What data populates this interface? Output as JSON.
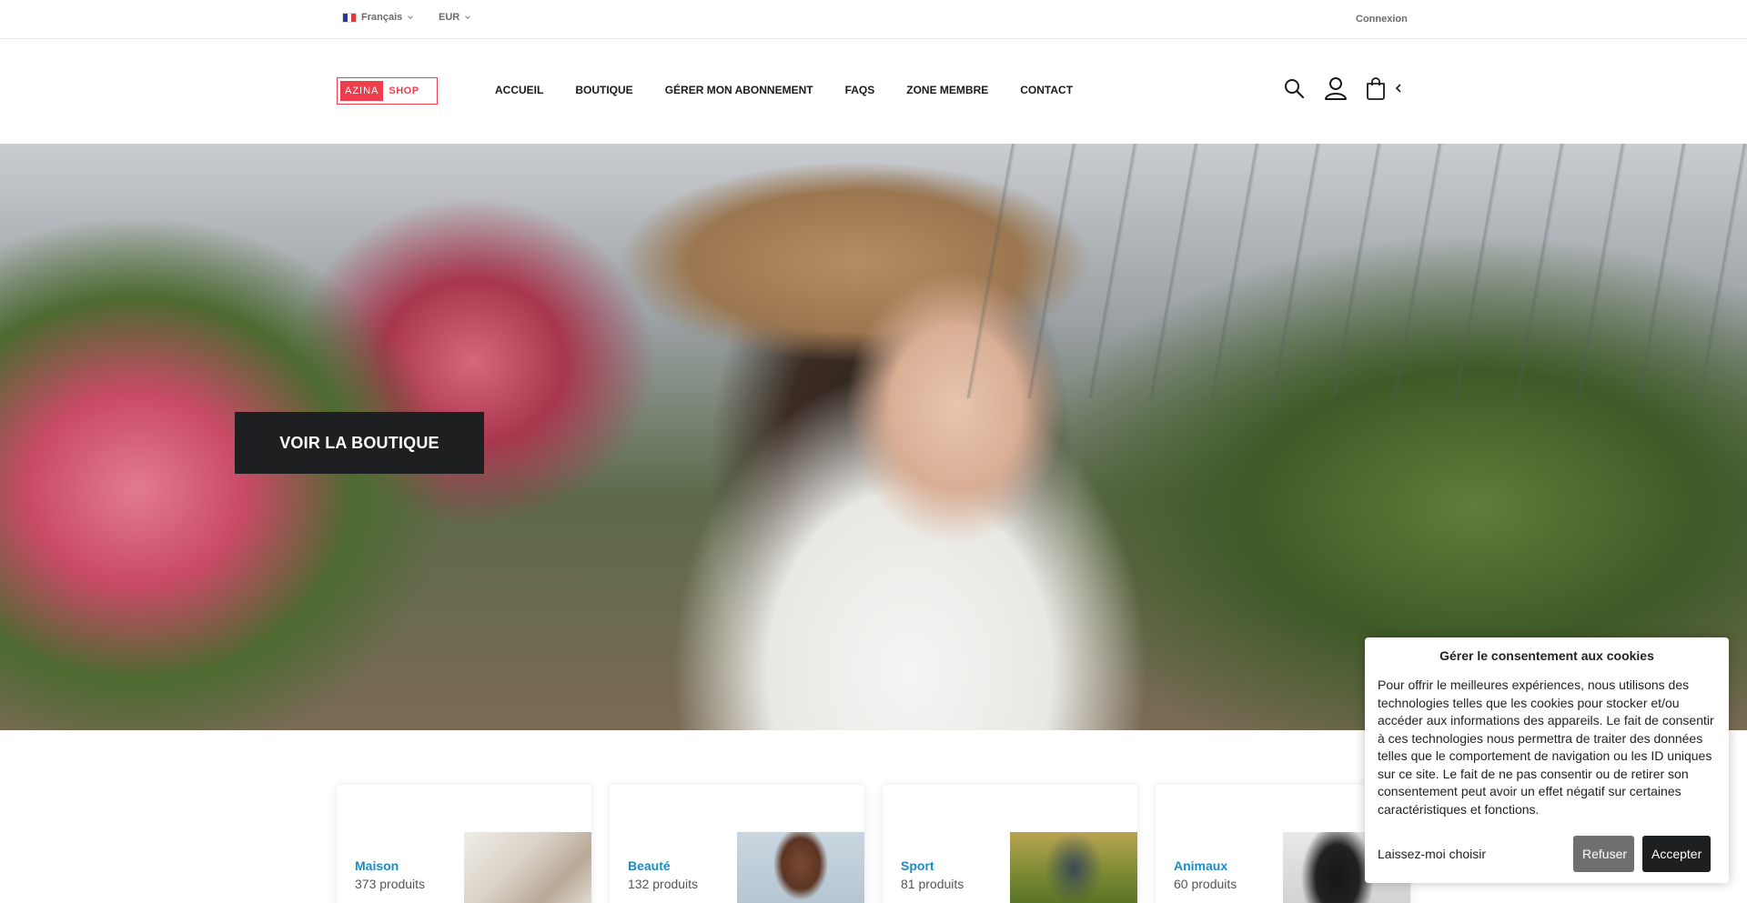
{
  "topbar": {
    "language": "Français",
    "currency": "EUR",
    "login": "Connexion"
  },
  "header": {
    "logo_part1": "AZINA",
    "logo_part2": "SHOP",
    "nav": [
      "ACCUEIL",
      "BOUTIQUE",
      "GÉRER MON ABONNEMENT",
      "FAQS",
      "ZONE MEMBRE",
      "CONTACT"
    ],
    "icons": [
      "search-icon",
      "user-icon",
      "bag-icon",
      "chevron-left-icon"
    ]
  },
  "hero": {
    "button_label": "VOIR LA BOUTIQUE"
  },
  "categories": [
    {
      "name": "Maison",
      "count": "373 produits"
    },
    {
      "name": "Beauté",
      "count": "132 produits"
    },
    {
      "name": "Sport",
      "count": "81 produits"
    },
    {
      "name": "Animaux",
      "count": "60 produits"
    }
  ],
  "cookie": {
    "title": "Gérer le consentement aux cookies",
    "text": "Pour offrir le meilleures expériences, nous utilisons des technologies telles que les cookies pour stocker et/ou accéder aux informations des appareils. Le fait de consentir à ces technologies nous permettra de traiter des données telles que le comportement de navigation ou les ID uniques sur ce site. Le fait de ne pas consentir ou de retirer son consentement peut avoir un effet négatif sur certaines caractéristiques et fonctions.",
    "preferences": "Laissez-moi choisir",
    "refuse": "Refuser",
    "accept": "Accepter"
  },
  "colors": {
    "brand": "#ee3e4e",
    "link": "#1b8dc0",
    "dark_button": "#1d1f20",
    "grey_button": "#6f6f6f"
  }
}
